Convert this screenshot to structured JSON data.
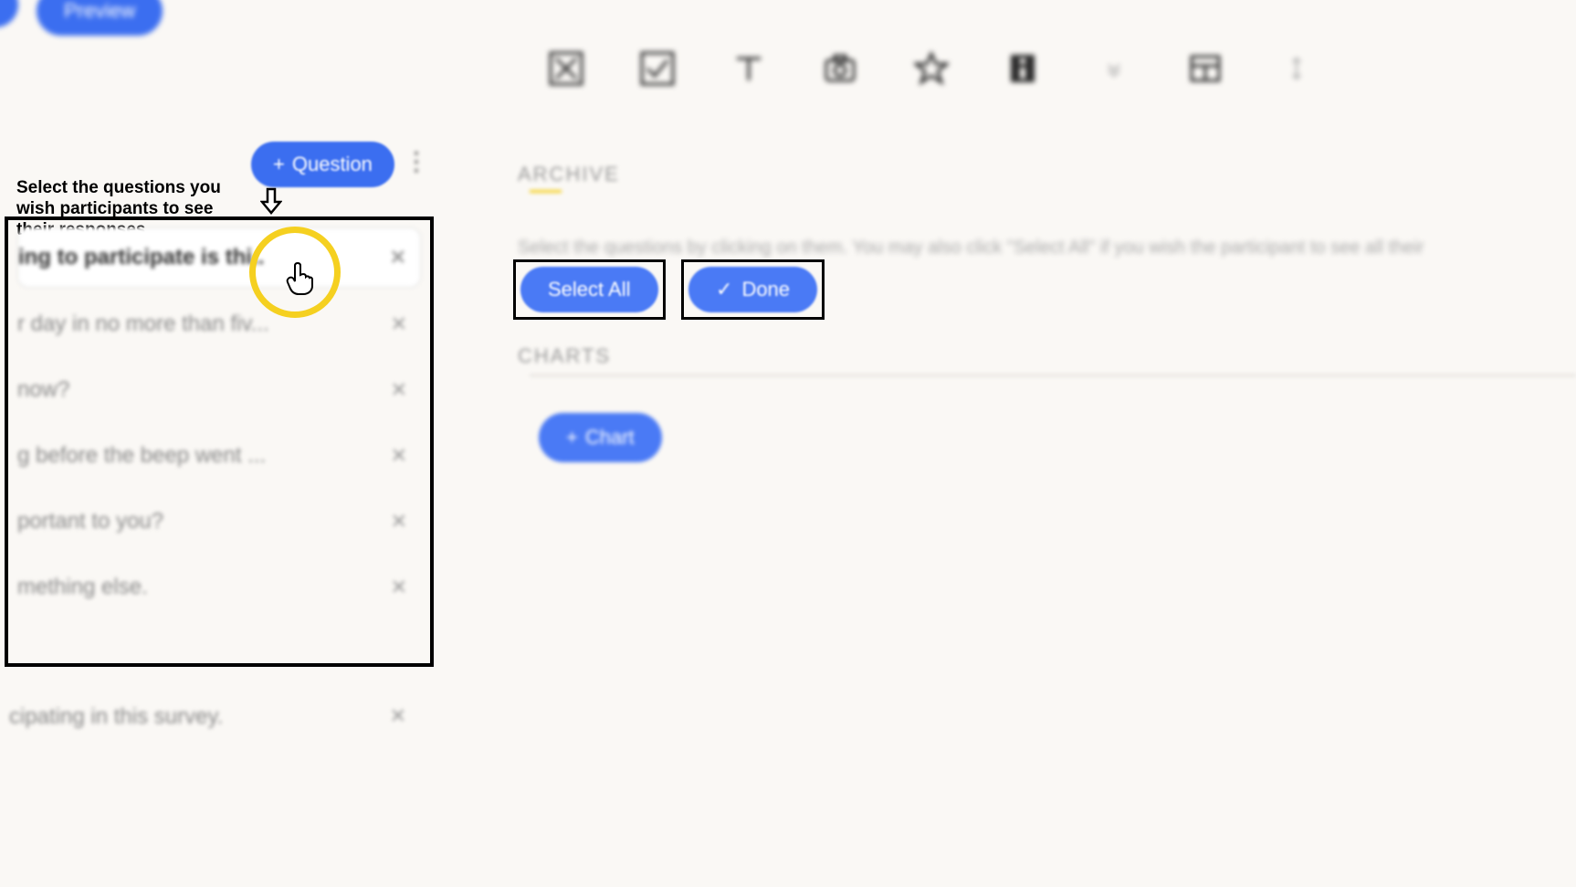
{
  "header": {
    "preview_label": "Preview"
  },
  "toolbar": {
    "question_label": "Question"
  },
  "instruction": "Select the questions you wish participants to see their responses.",
  "questions": [
    {
      "text": "ing to participate is thi.."
    },
    {
      "text": "r day in no more than fiv..."
    },
    {
      "text": "now?"
    },
    {
      "text": "g before the beep went ..."
    },
    {
      "text": "portant to you?"
    },
    {
      "text": "mething else."
    }
  ],
  "question_outside": "cipating in this survey.",
  "archive": {
    "label": "ARCHIVE",
    "description": "Select the questions by clicking on them. You may also click \"Select All\" if you wish the participant to see all their",
    "select_all_label": "Select All",
    "done_label": "Done"
  },
  "charts": {
    "label": "CHARTS",
    "chart_btn_label": "Chart"
  }
}
